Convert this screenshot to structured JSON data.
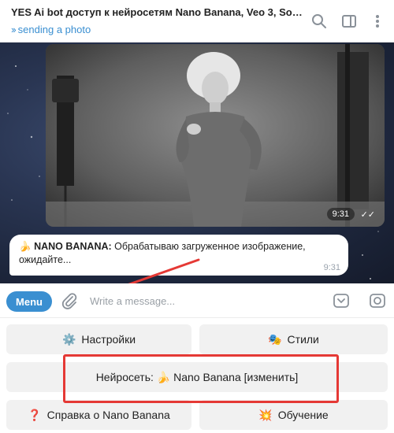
{
  "header": {
    "title": "YES Ai bot доступ к нейросетям Nano Banana, Veo 3, Sor...",
    "status": "sending a photo",
    "icons": [
      "search-icon",
      "sidebar-toggle-icon",
      "more-icon"
    ]
  },
  "photo_message": {
    "time": "9:31",
    "read_icon": "double-check-icon"
  },
  "text_message": {
    "emoji": "🍌",
    "sender": "NANO BANANA:",
    "text": " Обрабатываю загруженное изображение, ожидайте...",
    "time": "9:31"
  },
  "input": {
    "menu_label": "Menu",
    "placeholder": "Write a message...",
    "value": ""
  },
  "keyboard": {
    "settings": {
      "emoji": "⚙️",
      "label": "Настройки"
    },
    "styles": {
      "emoji": "🎭",
      "label": "Стили"
    },
    "model": {
      "label": "Нейросеть: 🍌 Nano Banana [изменить]"
    },
    "help": {
      "emoji": "❓",
      "label": "Справка о Nano Banana"
    },
    "learn": {
      "emoji": "💥",
      "label": "Обучение"
    }
  },
  "annotation_color": "#e53935",
  "accent_color": "#3a8fd1"
}
